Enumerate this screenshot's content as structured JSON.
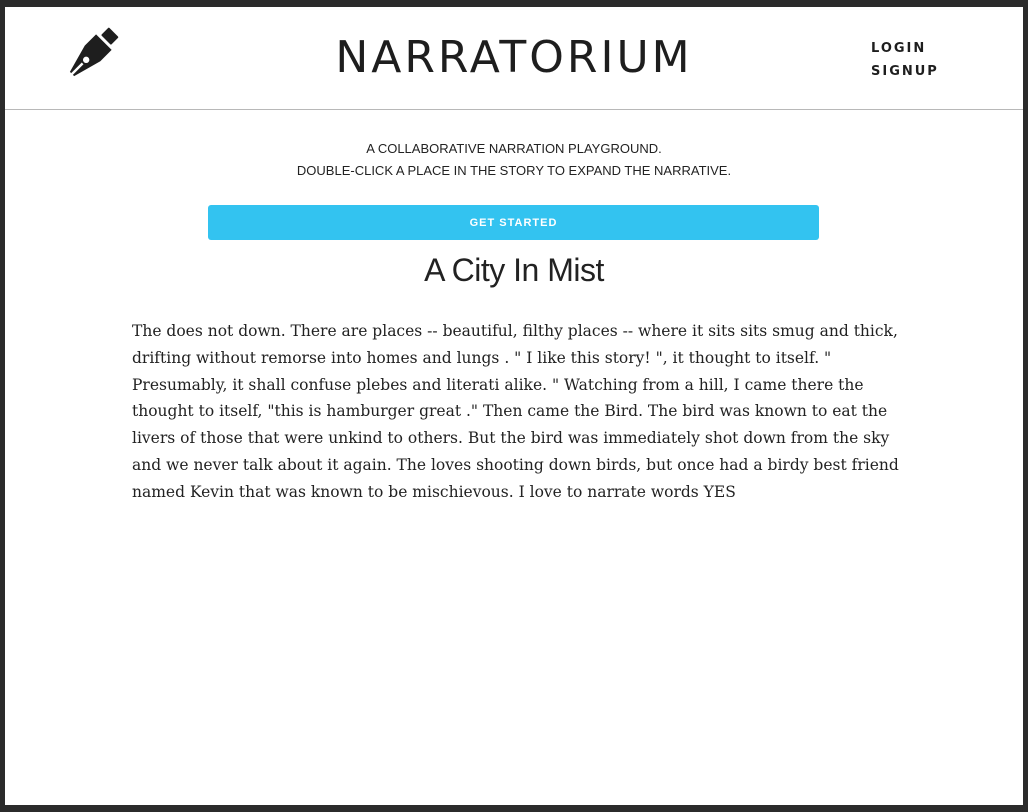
{
  "header": {
    "logo_icon": "fountain-pen-nib-icon",
    "site_title": "NARRATORIUM",
    "nav": {
      "login": "LOGIN",
      "signup": "SIGNUP"
    }
  },
  "intro": {
    "line1": "A COLLABORATIVE NARRATION PLAYGROUND.",
    "line2": "DOUBLE-CLICK A PLACE IN THE STORY TO EXPAND THE NARRATIVE.",
    "cta_label": "GET STARTED"
  },
  "story": {
    "title": "A City In Mist",
    "body": "The does not down. There are places -- beautiful, filthy places -- where it sits sits smug and thick, drifting without remorse into homes and lungs . \" I like this story! \", it thought to itself. \" Presumably, it shall confuse plebes and literati alike. \" Watching from a hill, I came there the thought to itself, \"this is hamburger great .\" Then came the Bird. The bird was known to eat the livers of those that were unkind to others. But the bird was immediately shot down from the sky and we never talk about it again. The loves shooting down birds, but once had a birdy best friend named Kevin that was known to be mischievous. I love to narrate words YES"
  },
  "colors": {
    "accent": "#33c3f0",
    "text": "#222222",
    "background": "#ffffff"
  }
}
